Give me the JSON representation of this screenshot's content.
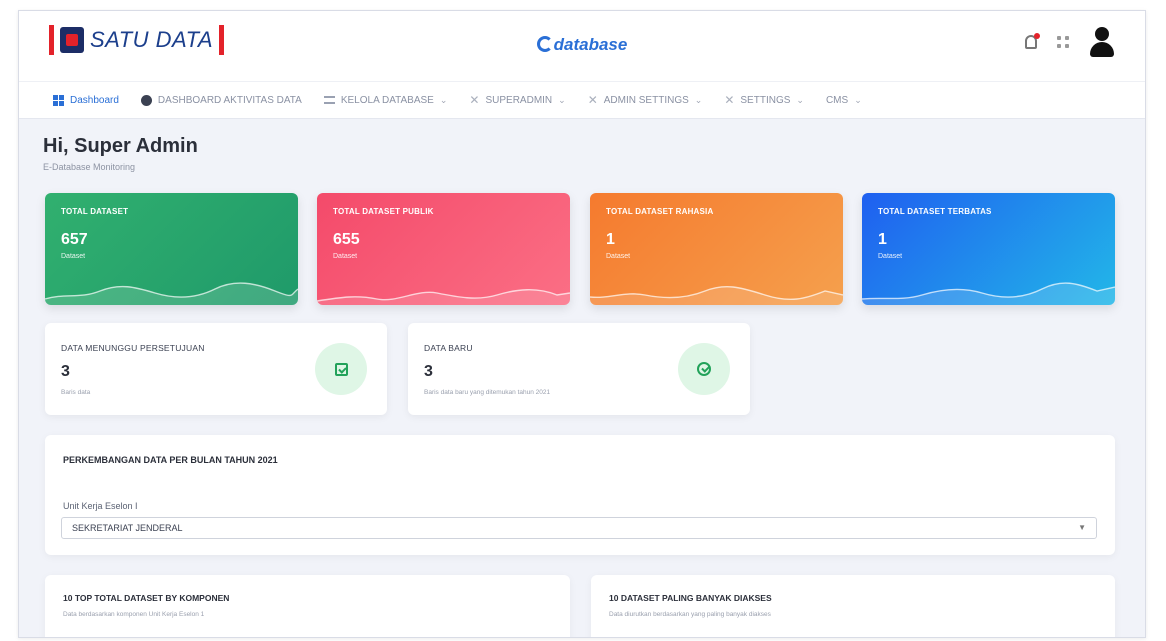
{
  "header": {
    "logo_text": "SATU DATA",
    "brand": "database",
    "icons": [
      "bell-icon",
      "apps-grid-icon",
      "user-avatar-icon"
    ]
  },
  "nav": [
    {
      "label": "Dashboard",
      "icon": "dashboard-icon",
      "caret": ""
    },
    {
      "label": "DASHBOARD AKTIVITAS DATA",
      "icon": "activity-icon",
      "caret": ""
    },
    {
      "label": "KELOLA DATABASE",
      "icon": "database-icon",
      "caret": "⌄"
    },
    {
      "label": "SUPERADMIN",
      "icon": "x-icon",
      "caret": "⌄"
    },
    {
      "label": "ADMIN SETTINGS",
      "icon": "x-icon",
      "caret": "⌄"
    },
    {
      "label": "SETTINGS",
      "icon": "x-icon",
      "caret": "⌄"
    },
    {
      "label": "CMS",
      "icon": "",
      "caret": "⌄"
    }
  ],
  "greeting": {
    "title": "Hi, Super Admin",
    "subtitle": "E-Database Monitoring"
  },
  "stats": [
    {
      "label": "TOTAL DATASET",
      "value": "657",
      "unit": "Dataset",
      "color": "#2aa86d"
    },
    {
      "label": "TOTAL DATASET PUBLIK",
      "value": "655",
      "unit": "Dataset",
      "color": "#f5566f"
    },
    {
      "label": "TOTAL DATASET RAHASIA",
      "value": "1",
      "unit": "Dataset",
      "color": "#f58a3a"
    },
    {
      "label": "TOTAL DATASET TERBATAS",
      "value": "1",
      "unit": "Dataset",
      "color": "#1f7bf0"
    }
  ],
  "mini_cards": [
    {
      "title": "DATA MENUNGGU PERSETUJUAN",
      "value": "3",
      "sub": "Baris data",
      "icon": "calendar-check-icon"
    },
    {
      "title": "DATA BARU",
      "value": "3",
      "sub": "Baris data baru yang ditemukan tahun 2021",
      "icon": "check-circle-icon"
    }
  ],
  "development": {
    "title": "PERKEMBANGAN DATA PER BULAN TAHUN 2021",
    "filter_label": "Unit Kerja Eselon I",
    "filter_value": "SEKRETARIAT JENDERAL"
  },
  "bottom": [
    {
      "title": "10 TOP TOTAL DATASET BY KOMPONEN",
      "sub": "Data berdasarkan komponen Unit Kerja Eselon 1"
    },
    {
      "title": "10 DATASET PALING BANYAK DIAKSES",
      "sub": "Data diurutkan berdasarkan yang paling banyak diakses"
    }
  ]
}
